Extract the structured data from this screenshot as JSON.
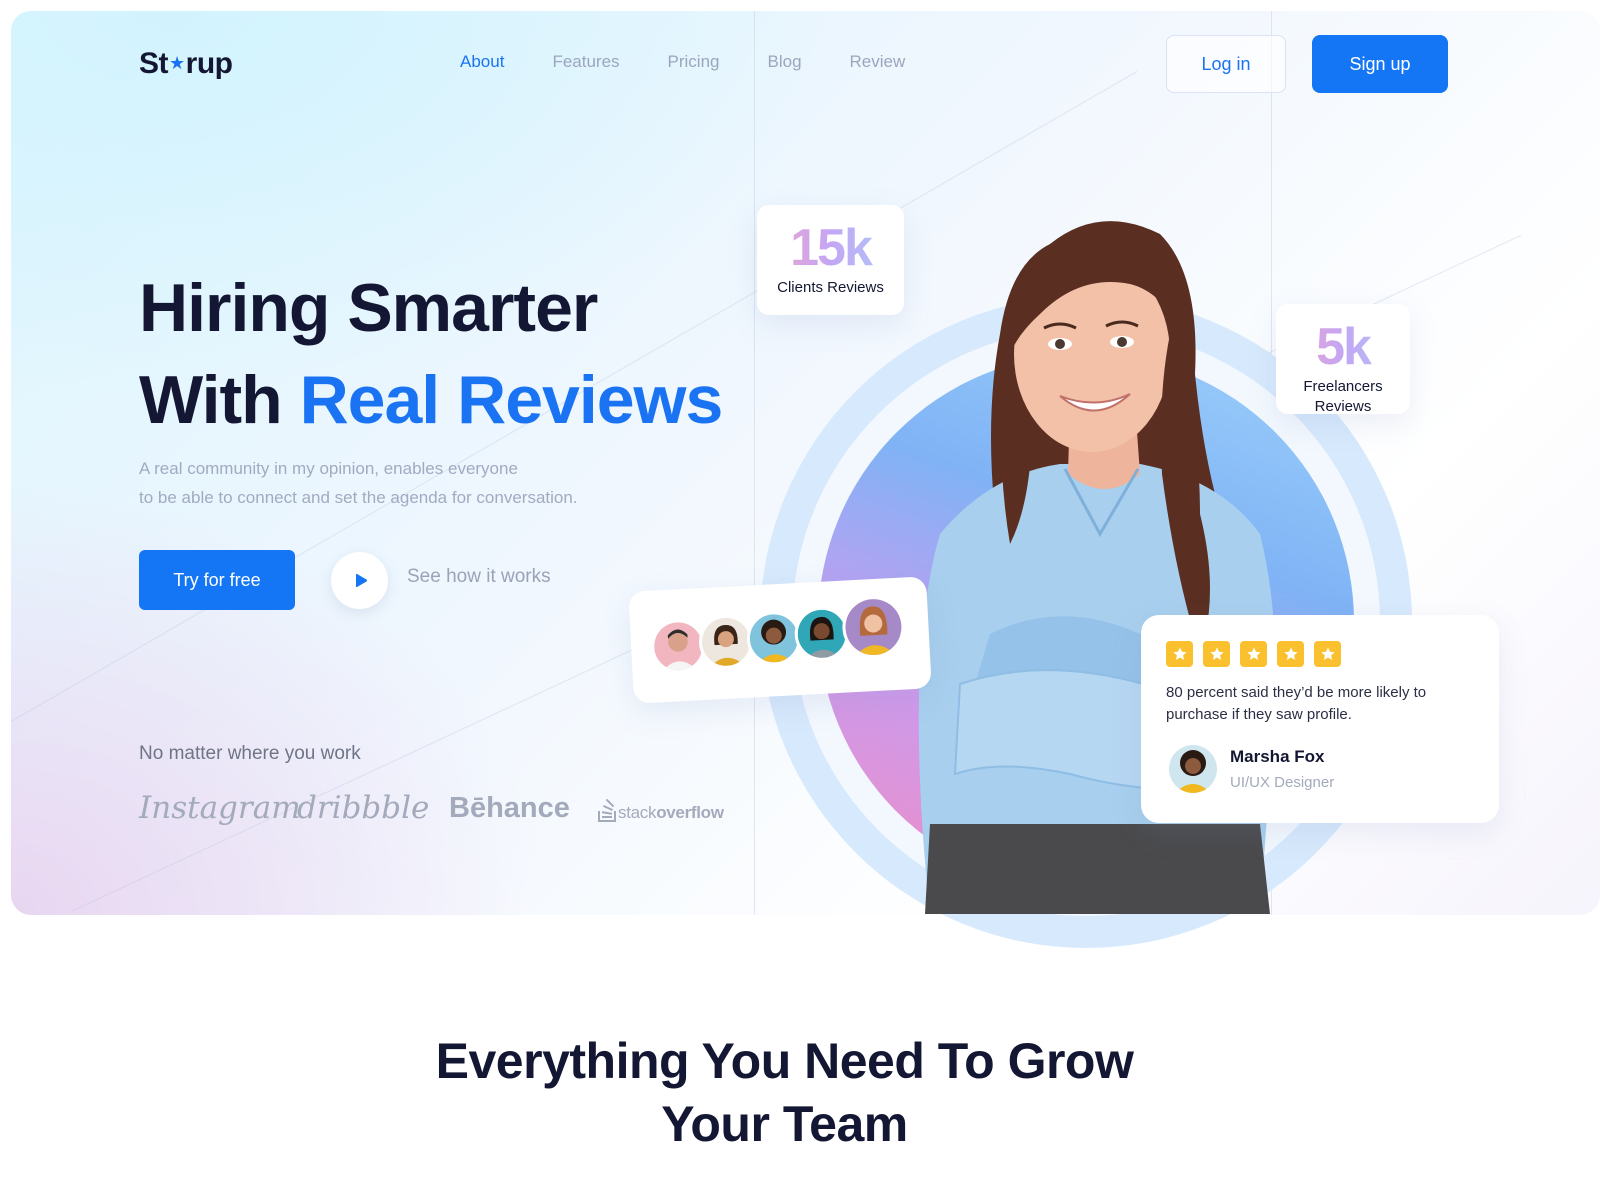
{
  "logo": {
    "before": "St",
    "star": "★",
    "after": "rup"
  },
  "nav": {
    "items": [
      {
        "label": "About",
        "active": true
      },
      {
        "label": "Features"
      },
      {
        "label": "Pricing"
      },
      {
        "label": "Blog"
      },
      {
        "label": "Review"
      }
    ]
  },
  "auth": {
    "login_label": "Log in",
    "signup_label": "Sign up"
  },
  "hero": {
    "headline_line1": "Hiring Smarter",
    "headline_line2_prefix": "With ",
    "headline_line2_highlight": "Real Reviews",
    "subtext_line1": "A real community in my opinion, enables everyone",
    "subtext_line2": "to be able to connect and set the agenda for conversation.",
    "cta_label": "Try for free",
    "video_label": "See how it works"
  },
  "brands": {
    "heading": "No matter where you work",
    "items": [
      "Instagram",
      "dribbble",
      "Bēhance",
      "stack",
      "overflow"
    ]
  },
  "stats": [
    {
      "value": "15k",
      "label": "Clients Reviews"
    },
    {
      "value": "5k",
      "label_line1": "Freelancers",
      "label_line2": "Reviews"
    }
  ],
  "review": {
    "rating": 5,
    "text": "80 percent said they’d be more likely to purchase if they saw profile.",
    "name": "Marsha Fox",
    "role": "UI/UX Designer"
  },
  "section": {
    "title_line1": "Everything You Need To Grow",
    "title_line2": "Your Team"
  },
  "colors": {
    "accent": "#1476f5",
    "dark_text": "#141733",
    "star": "#fbc02d"
  }
}
